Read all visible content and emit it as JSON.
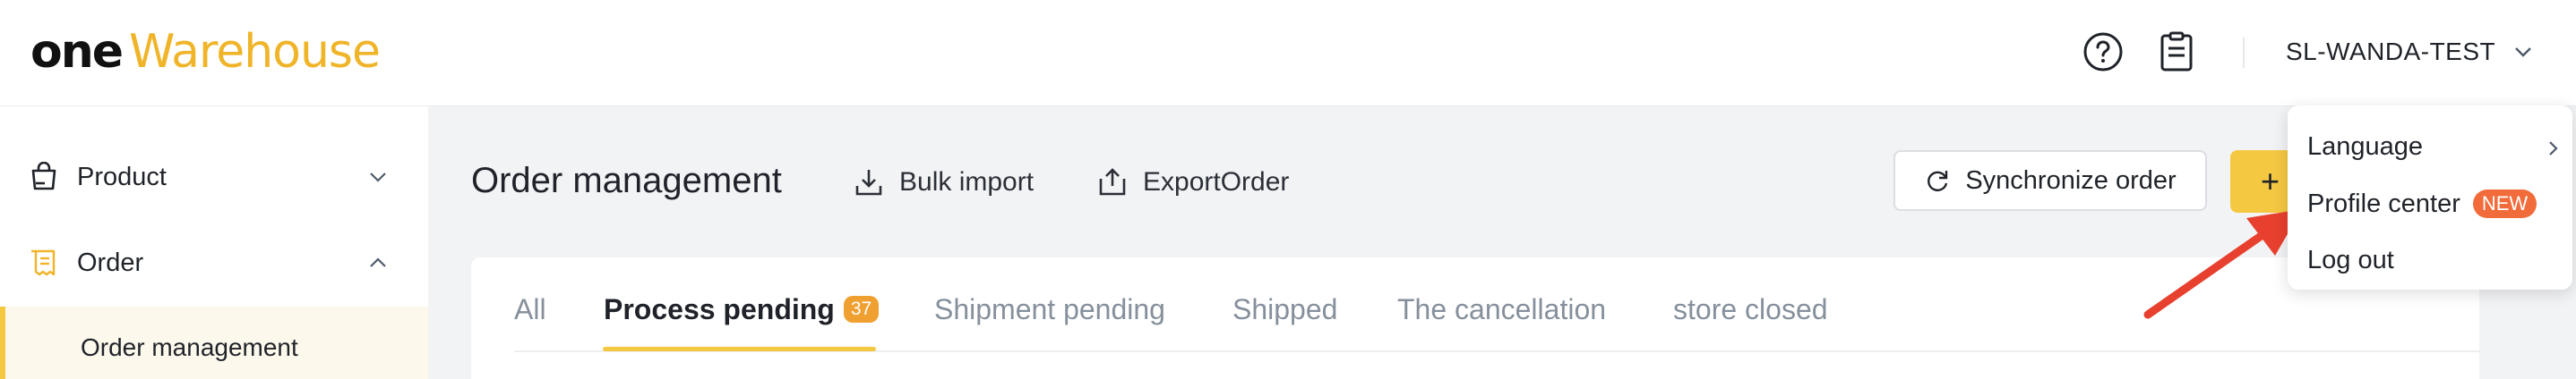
{
  "header": {
    "logo": {
      "part1": "one",
      "part2": "Warehouse"
    },
    "account_name": "SL-WANDA-TEST",
    "icons": [
      "help-circle-icon",
      "clipboard-icon",
      "chevron-down-icon"
    ]
  },
  "sidebar": {
    "items": [
      {
        "label": "Product",
        "icon": "bag-icon",
        "expanded": false
      },
      {
        "label": "Order",
        "icon": "receipt-icon",
        "expanded": true
      }
    ],
    "sub_items": [
      {
        "label": "Order management",
        "active": true
      }
    ]
  },
  "main": {
    "title": "Order management",
    "toolbar": {
      "bulk_import": "Bulk import",
      "export_order": "ExportOrder",
      "synchronize": "Synchronize order",
      "add_symbol": "+"
    },
    "tabs": [
      {
        "label": "All"
      },
      {
        "label": "Process pending",
        "badge": "37",
        "active": true
      },
      {
        "label": "Shipment pending"
      },
      {
        "label": "Shipped"
      },
      {
        "label": "The cancellation"
      },
      {
        "label": "store closed"
      }
    ]
  },
  "dropdown": {
    "items": [
      {
        "label": "Language",
        "has_submenu": true
      },
      {
        "label": "Profile center",
        "tag": "NEW"
      },
      {
        "label": "Log out"
      }
    ]
  },
  "colors": {
    "accent": "#f5c842",
    "logo_accent": "#f0b429",
    "badge": "#f0a030",
    "new_tag": "#f26b3a",
    "annotation_arrow": "#e8402e"
  }
}
